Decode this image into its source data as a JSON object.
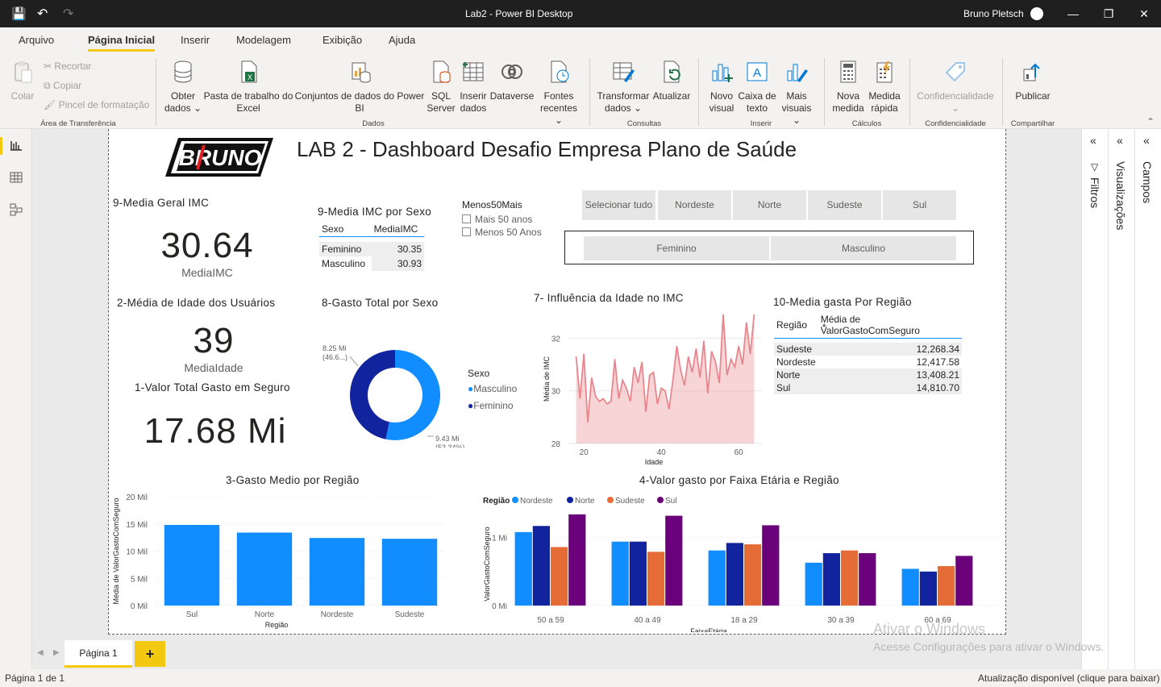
{
  "window": {
    "title": "Lab2 - Power BI Desktop",
    "user": "Bruno Pletsch"
  },
  "menu": [
    "Arquivo",
    "Página Inicial",
    "Inserir",
    "Modelagem",
    "Exibição",
    "Ajuda"
  ],
  "ribbon": {
    "colar": "Colar",
    "recortar": "Recortar",
    "copiar": "Copiar",
    "pincel": "Pincel de formatação",
    "obter": [
      "Obter",
      "dados"
    ],
    "pasta": [
      "Pasta de trabalho do",
      "Excel"
    ],
    "conjuntos": [
      "Conjuntos de dados do Power",
      "BI"
    ],
    "sql": [
      "SQL",
      "Server"
    ],
    "inserir_dados": [
      "Inserir",
      "dados"
    ],
    "dataverse": "Dataverse",
    "fontes": [
      "Fontes",
      "recentes"
    ],
    "transformar": [
      "Transformar",
      "dados"
    ],
    "atualizar": "Atualizar",
    "novo_visual": [
      "Novo",
      "visual"
    ],
    "caixa_texto": [
      "Caixa de",
      "texto"
    ],
    "mais_visuais": [
      "Mais",
      "visuais"
    ],
    "nova_medida": [
      "Nova",
      "medida"
    ],
    "medida_rapida": [
      "Medida",
      "rápida"
    ],
    "confidencialidade": "Confidencialidade",
    "publicar": "Publicar",
    "groups": {
      "area": "Área de Transferência",
      "dados": "Dados",
      "consultas": "Consultas",
      "inserir": "Inserir",
      "calculos": "Cálculos",
      "conf": "Confidencialidade",
      "compartilhar": "Compartilhar"
    }
  },
  "panes": {
    "filtros": "Filtros",
    "visualizacoes": "Visualizações",
    "campos": "Campos"
  },
  "report": {
    "title": "LAB 2 - Dashboard Desafio Empresa Plano de Saúde",
    "logo": "BRUNO",
    "imc_card": {
      "title": "9-Media Geral IMC",
      "value": "30.64",
      "caption": "MediaIMC"
    },
    "idade_card": {
      "title": "2-Média de Idade dos Usuários",
      "value": "39",
      "caption": "MediaIdade"
    },
    "valor_card": {
      "title": "1-Valor Total Gasto em Seguro",
      "value": "17.68 Mi"
    },
    "imc_sexo": {
      "title": "9-Media IMC por Sexo",
      "headers": [
        "Sexo",
        "MediaIMC"
      ],
      "rows": [
        [
          "Feminino",
          "30.35"
        ],
        [
          "Masculino",
          "30.93"
        ]
      ]
    },
    "menos50": {
      "title": "Menos50Mais",
      "options": [
        "Mais 50 anos",
        "Menos 50 Anos"
      ]
    },
    "region_slicer": [
      "Selecionar tudo",
      "Nordeste",
      "Norte",
      "Sudeste",
      "Sul"
    ],
    "sex_slicer": [
      "Feminino",
      "Masculino"
    ],
    "media_regiao": {
      "title": "10-Media gasta Por Região",
      "headers": [
        "Região",
        "Média de ValorGastoComSeguro"
      ],
      "rows": [
        [
          "Sudeste",
          "12,268.34"
        ],
        [
          "Nordeste",
          "12,417.58"
        ],
        [
          "Norte",
          "13,408.21"
        ],
        [
          "Sul",
          "14,810.70"
        ]
      ]
    }
  },
  "chart_data": [
    {
      "type": "pie",
      "title": "8-Gasto Total por Sexo",
      "legend_title": "Sexo",
      "categories": [
        "Masculino",
        "Feminino"
      ],
      "values": [
        9.43,
        8.25
      ],
      "labels": [
        "9.43 Mi",
        "8.25 Mi"
      ],
      "pct_labels": [
        "(53.34%)",
        "(46.6...)"
      ],
      "colors": [
        "#118dff",
        "#12239e"
      ]
    },
    {
      "type": "area",
      "title": "7- Influência da Idade no IMC",
      "xlabel": "Idade",
      "ylabel": "Média de IMC",
      "xticks": [
        20,
        40,
        60
      ],
      "yticks": [
        28,
        30,
        32
      ],
      "ylim": [
        28,
        32.9
      ],
      "xlim": [
        16,
        66
      ],
      "x": [
        18,
        19,
        20,
        21,
        22,
        23,
        24,
        25,
        26,
        27,
        28,
        29,
        30,
        31,
        32,
        33,
        34,
        35,
        36,
        37,
        38,
        39,
        40,
        41,
        42,
        43,
        44,
        45,
        46,
        47,
        48,
        49,
        50,
        51,
        52,
        53,
        54,
        55,
        56,
        57,
        58,
        59,
        60,
        61,
        62,
        63,
        64
      ],
      "values": [
        31.3,
        29.7,
        31.4,
        28.8,
        30.5,
        29.8,
        29.6,
        29.7,
        29.5,
        29.6,
        31.2,
        29.7,
        30.4,
        30.1,
        29.6,
        30.9,
        30.3,
        31.1,
        29.2,
        30.6,
        30.7,
        29.5,
        30.1,
        30.0,
        29.3,
        30.4,
        31.7,
        30.8,
        30.2,
        31.3,
        30.7,
        31.6,
        30.5,
        31.9,
        29.9,
        31.5,
        31.1,
        30.3,
        32.9,
        30.6,
        31.2,
        30.9,
        31.7,
        31.0,
        32.6,
        31.4,
        32.9
      ],
      "color": "#e8868d"
    },
    {
      "type": "bar",
      "title": "3-Gasto Medio por Região",
      "xlabel": "Região",
      "ylabel": "Média de ValorGastoComSeguro",
      "categories": [
        "Sul",
        "Norte",
        "Nordeste",
        "Sudeste"
      ],
      "values": [
        14810.7,
        13408.21,
        12417.58,
        12268.34
      ],
      "yticks": [
        "0 Mil",
        "5 Mil",
        "10 Mil",
        "15 Mil",
        "20 Mil"
      ],
      "ylim": [
        0,
        20000
      ],
      "color": "#118dff"
    },
    {
      "type": "bar",
      "title": "4-Valor gasto por Faixa Etária e Região",
      "legend_title": "Região",
      "xlabel": "FaixaEtária",
      "ylabel": "ValorGastoComSeguro",
      "categories": [
        "50 a 59",
        "40 a 49",
        "18 a 29",
        "30 a 39",
        "60 a 69"
      ],
      "yticks": [
        "0 Mi",
        "1 Mi"
      ],
      "ylim": [
        0,
        1.6
      ],
      "series": [
        {
          "name": "Nordeste",
          "color": "#118dff",
          "values": [
            1.08,
            0.94,
            0.81,
            0.63,
            0.54
          ]
        },
        {
          "name": "Norte",
          "color": "#12239e",
          "values": [
            1.17,
            0.94,
            0.92,
            0.77,
            0.5
          ]
        },
        {
          "name": "Sudeste",
          "color": "#e66c37",
          "values": [
            0.86,
            0.79,
            0.9,
            0.81,
            0.58
          ]
        },
        {
          "name": "Sul",
          "color": "#6b007b",
          "values": [
            1.34,
            1.32,
            1.18,
            0.77,
            0.73
          ]
        }
      ]
    }
  ],
  "pages": {
    "tab": "Página 1",
    "add": "+"
  },
  "status": {
    "left": "Página 1 de 1",
    "right": "Atualização disponível (clique para baixar)"
  },
  "watermark": {
    "line1": "Ativar o Windows",
    "line2": "Acesse Configurações para ativar o Windows."
  }
}
